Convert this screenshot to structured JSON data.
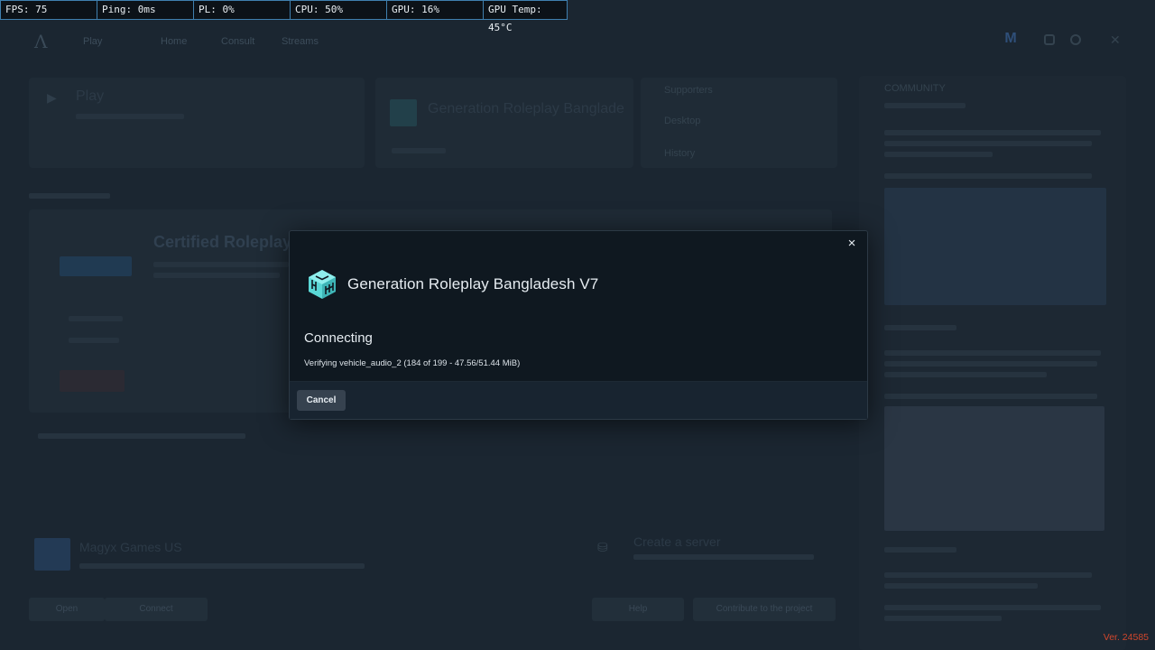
{
  "perf": {
    "fps": "FPS: 75",
    "ping": "Ping: 0ms",
    "pl": "PL: 0%",
    "cpu": "CPU: 50%",
    "gpu": "GPU: 16%",
    "gpu_temp": "GPU Temp: 45°C"
  },
  "nav": {
    "items": [
      "Play",
      "Home",
      "Consult",
      "Streams"
    ],
    "avatar_letter": "M"
  },
  "background": {
    "play_label": "Play",
    "featured_server": "Generation Roleplay Banglade",
    "side_links": [
      "Supporters",
      "Desktop",
      "History"
    ],
    "certified_title": "Certified Roleplay",
    "community_heading": "COMMUNITY",
    "recent_server": "Magyx Games US",
    "create_server": "Create a server",
    "bottom_buttons": [
      "Open",
      "Connect",
      "Help",
      "Contribute to the project"
    ]
  },
  "modal": {
    "server_name": "Generation Roleplay Bangladesh V7",
    "status": "Connecting",
    "detail": "Verifying vehicle_audio_2 (184 of 199 - 47.56/51.44 MiB)",
    "cancel_label": "Cancel",
    "close_symbol": "×"
  },
  "version": "Ver. 24585",
  "colors": {
    "background": "#1b2631",
    "modal": "#0f1820",
    "accent_icon": "#5ad7d6",
    "version_text": "#d0462c",
    "perf_border": "#3f7fae"
  }
}
